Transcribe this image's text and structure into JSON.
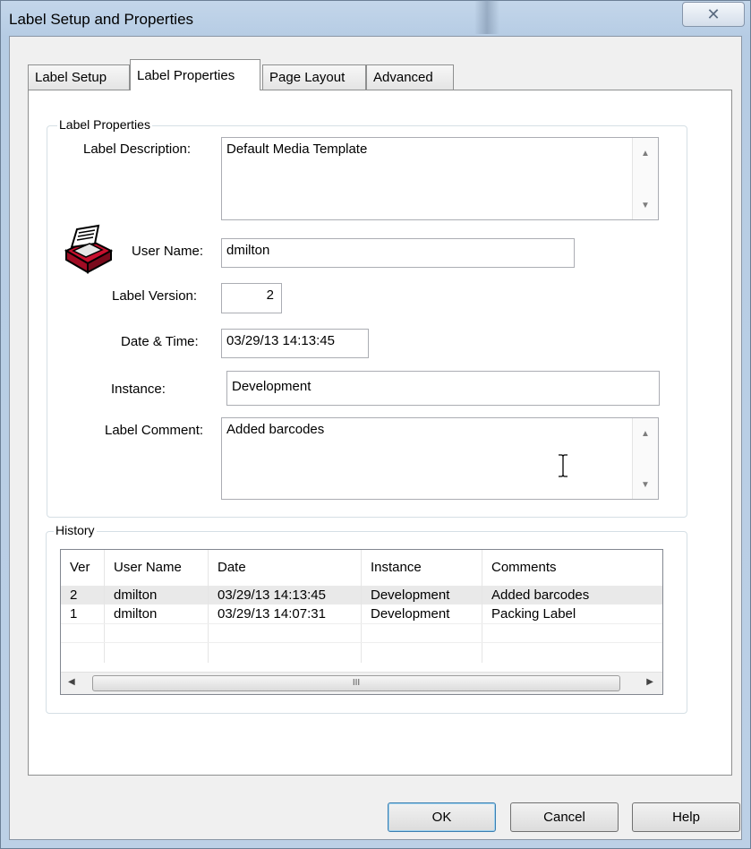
{
  "window": {
    "title": "Label Setup and Properties",
    "close_glyph": "✕"
  },
  "tabs": [
    {
      "label": "Label Setup"
    },
    {
      "label": "Label Properties"
    },
    {
      "label": "Page Layout"
    },
    {
      "label": "Advanced"
    }
  ],
  "properties": {
    "group_title": "Label Properties",
    "description_label": "Label Description:",
    "description_value": "Default Media Template",
    "username_label": "User Name:",
    "username_value": "dmilton",
    "version_label": "Label Version:",
    "version_value": "2",
    "datetime_label": "Date & Time:",
    "datetime_value": "03/29/13 14:13:45",
    "instance_label": "Instance:",
    "instance_value": "Development",
    "comment_label": "Label Comment:",
    "comment_value": "Added barcodes"
  },
  "history": {
    "group_title": "History",
    "columns": [
      "Ver",
      "User Name",
      "Date",
      "Instance",
      "Comments"
    ],
    "rows": [
      [
        "2",
        "dmilton",
        "03/29/13 14:13:45",
        "Development",
        "Added barcodes"
      ],
      [
        "1",
        "dmilton",
        "03/29/13 14:07:31",
        "Development",
        "Packing Label"
      ]
    ],
    "scroll_thumb_glyph": "III"
  },
  "buttons": {
    "ok": "OK",
    "cancel": "Cancel",
    "help": "Help"
  }
}
